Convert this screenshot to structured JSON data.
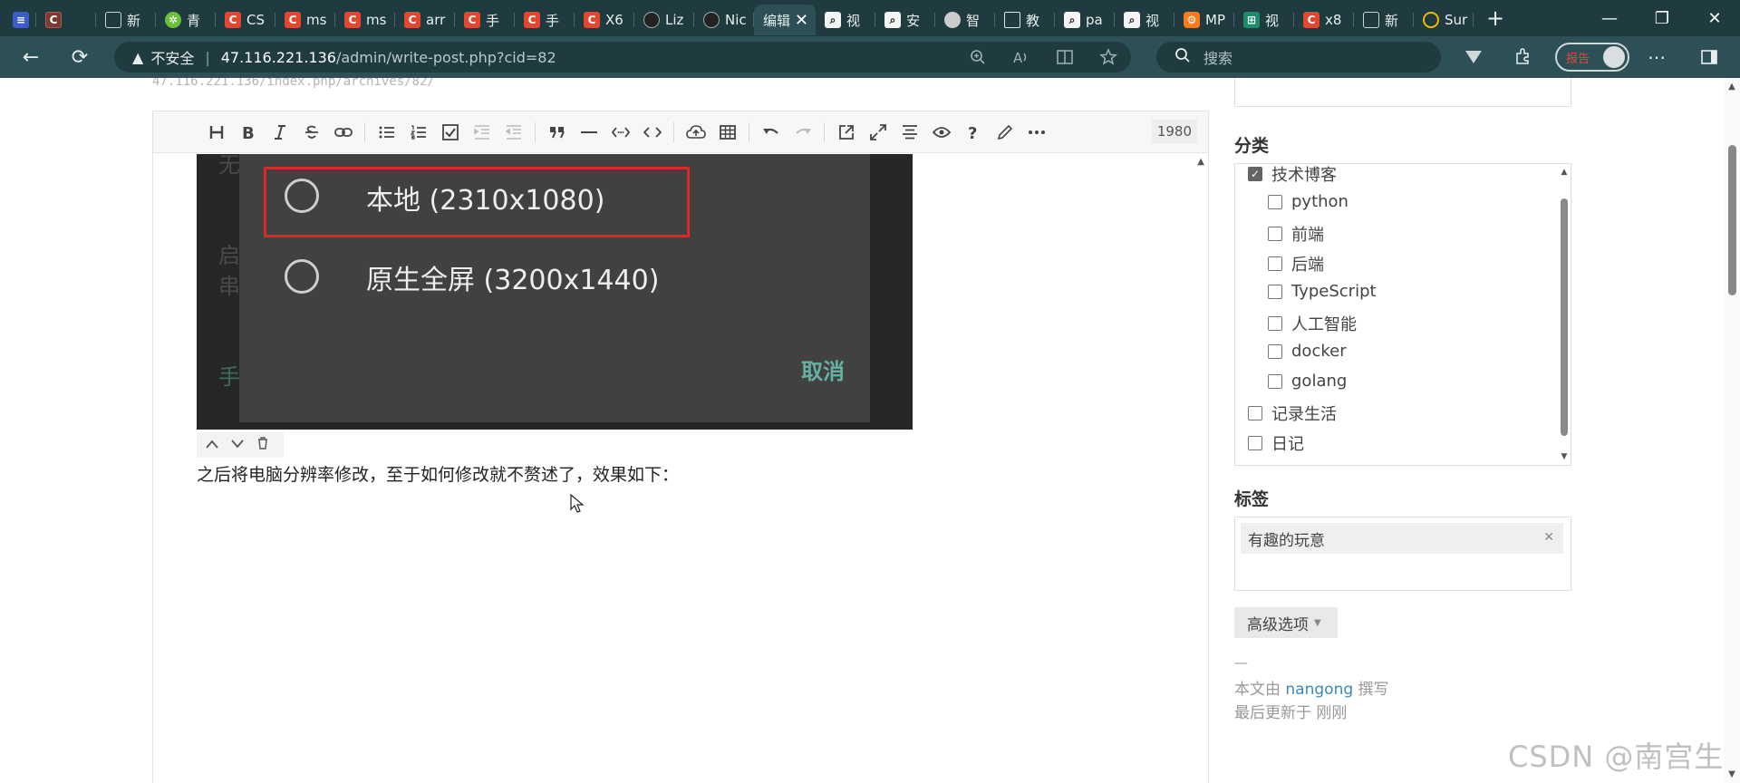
{
  "tabs": [
    {
      "label": "",
      "favicon": "doc",
      "active": false
    },
    {
      "label": "",
      "favicon": "dark-csdn",
      "active": false
    },
    {
      "label": "新",
      "favicon": "newtab",
      "active": false
    },
    {
      "label": "青",
      "favicon": "green",
      "active": false
    },
    {
      "label": "CS",
      "favicon": "csdn",
      "active": false
    },
    {
      "label": "ms",
      "favicon": "csdn",
      "active": false
    },
    {
      "label": "ms",
      "favicon": "csdn",
      "active": false
    },
    {
      "label": "arr",
      "favicon": "csdn",
      "active": false
    },
    {
      "label": "手",
      "favicon": "csdn",
      "active": false
    },
    {
      "label": "手",
      "favicon": "csdn",
      "active": false
    },
    {
      "label": "X6",
      "favicon": "csdn",
      "active": false
    },
    {
      "label": "Liz",
      "favicon": "github",
      "active": false
    },
    {
      "label": "Nic",
      "favicon": "github",
      "active": false
    },
    {
      "label": "编辑",
      "favicon": "",
      "active": true
    },
    {
      "label": "视",
      "favicon": "search",
      "active": false
    },
    {
      "label": "安",
      "favicon": "search",
      "active": false
    },
    {
      "label": "智",
      "favicon": "cd",
      "active": false
    },
    {
      "label": "教",
      "favicon": "page",
      "active": false
    },
    {
      "label": "pa",
      "favicon": "search",
      "active": false
    },
    {
      "label": "视",
      "favicon": "search",
      "active": false
    },
    {
      "label": "MP",
      "favicon": "orange",
      "active": false
    },
    {
      "label": "视",
      "favicon": "teal",
      "active": false
    },
    {
      "label": "x8",
      "favicon": "csdn",
      "active": false
    },
    {
      "label": "新",
      "favicon": "newtab",
      "active": false
    },
    {
      "label": "Sur",
      "favicon": "yellow",
      "active": false
    }
  ],
  "window": {
    "minimize": "—",
    "restore": "❐",
    "close": "✕",
    "new_tab": "+",
    "tab_close": "✕"
  },
  "nav": {
    "back": "←",
    "reload": "⟳",
    "warning_icon": "▲",
    "insecure_label": "不安全",
    "separator": "|"
  },
  "address": {
    "host": "47.116.221.136",
    "path": "/admin/write-post.php?cid=82"
  },
  "search": {
    "placeholder": "搜索",
    "icon": "search-icon"
  },
  "profile": {
    "label": "报告"
  },
  "page": {
    "prev_url": "47.116.221.136/index.php/archives/82/",
    "word_count": "1980",
    "editor_paragraph": "之后将电脑分辨率修改，至于如何修改就不赘述了，效果如下：",
    "image": {
      "option1": "本地 (2310x1080)",
      "option2": "原生全屏 (3200x1440)",
      "cancel": "取消",
      "bg_text_1": "无",
      "bg_text_2": "启",
      "bg_text_3": "串",
      "bg_text_4": "手"
    }
  },
  "toolbar": {
    "tools": [
      "heading",
      "bold",
      "italic",
      "strikethrough",
      "link",
      "bullet-list",
      "ordered-list",
      "task-list",
      "indent",
      "outdent",
      "quote",
      "horizontal-rule",
      "code-inline",
      "code-block",
      "upload",
      "table",
      "undo",
      "redo",
      "open-external",
      "fullscreen",
      "align",
      "preview",
      "help",
      "edit",
      "more"
    ]
  },
  "sidebar": {
    "category_title": "分类",
    "categories": [
      {
        "label": "技术博客",
        "checked": true,
        "level": 0
      },
      {
        "label": "python",
        "checked": false,
        "level": 1
      },
      {
        "label": "前端",
        "checked": false,
        "level": 1
      },
      {
        "label": "后端",
        "checked": false,
        "level": 1
      },
      {
        "label": "TypeScript",
        "checked": false,
        "level": 1
      },
      {
        "label": "人工智能",
        "checked": false,
        "level": 1
      },
      {
        "label": "docker",
        "checked": false,
        "level": 1
      },
      {
        "label": "golang",
        "checked": false,
        "level": 1
      },
      {
        "label": "记录生活",
        "checked": false,
        "level": 0
      },
      {
        "label": "日记",
        "checked": false,
        "level": 0
      }
    ],
    "tag_title": "标签",
    "tags": [
      "有趣的玩意"
    ],
    "advanced_label": "高级选项",
    "dash": "—",
    "author_prefix": "本文由",
    "author": "nangong",
    "author_suffix": "撰写",
    "updated": "最后更新于 刚刚"
  },
  "watermark": "CSDN @南宫生",
  "colors": {
    "browser_frame": "#1f3b3f",
    "toolbar": "#2c5055",
    "link": "#3a87b8",
    "highlight_red": "#d8282a",
    "cancel_teal": "#66b0a4"
  }
}
